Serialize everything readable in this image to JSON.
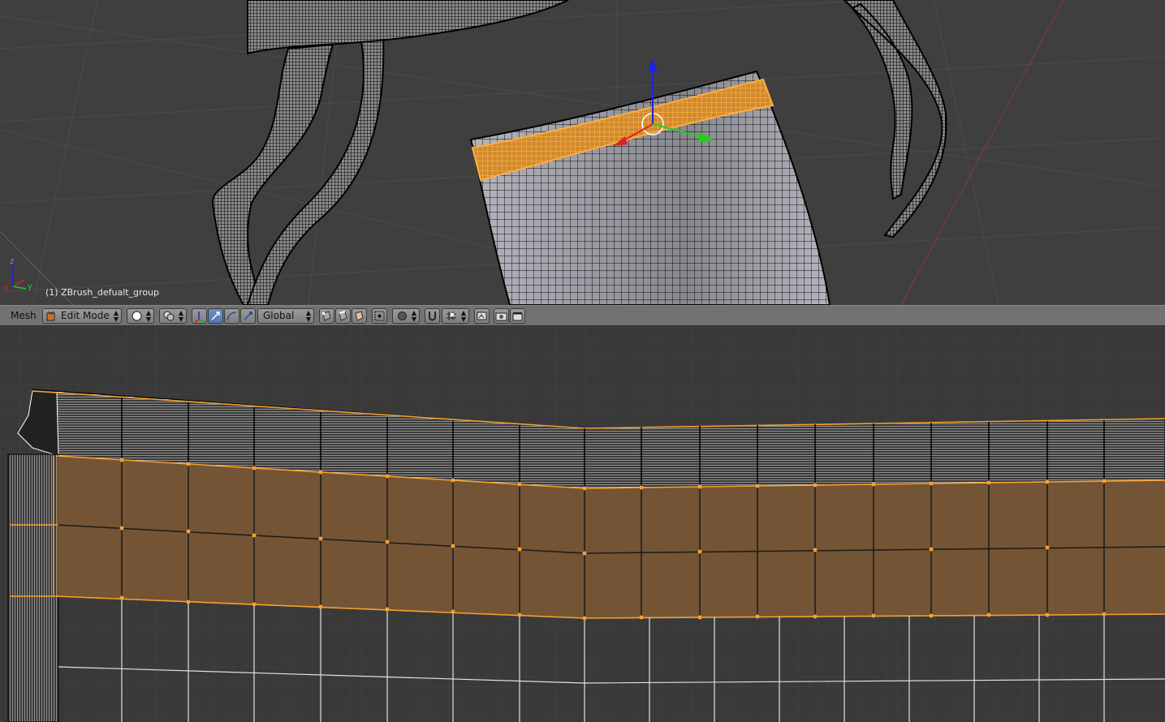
{
  "viewport_top": {
    "object_label": "(1) ZBrush_defualt_group",
    "axis_labels": {
      "x": "x",
      "y": "y",
      "z": "z"
    }
  },
  "header": {
    "menu_label": "Mesh",
    "mode_label": "Edit Mode",
    "orientation_label": "Global"
  },
  "colors": {
    "selection": "#f5a030",
    "selection_fill": "#7a5834",
    "grid": "#4a4a4a",
    "mesh_wire": "#000000",
    "widget_x": "#e02020",
    "widget_y": "#20d020",
    "widget_z": "#2020e0"
  },
  "icons": [
    "mode-icon",
    "shading-solid-icon",
    "pivot-icon",
    "manipulator-icon",
    "translate-icon",
    "rotate-icon",
    "scale-icon",
    "vertex-select-icon",
    "edge-select-icon",
    "face-select-icon",
    "occlude-icon",
    "proportional-icon",
    "snap-icon",
    "snap-target-icon",
    "render-icon",
    "camera-icon",
    "clapper-icon"
  ]
}
